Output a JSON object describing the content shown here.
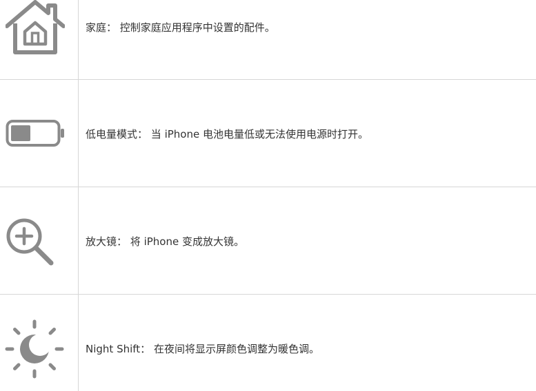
{
  "rows": [
    {
      "icon": "home-icon",
      "term": "家庭：",
      "desc": "控制家庭应用程序中设置的配件。"
    },
    {
      "icon": "low-battery-icon",
      "term": "低电量模式：",
      "desc": "当 iPhone 电池电量低或无法使用电源时打开。"
    },
    {
      "icon": "magnifier-icon",
      "term": "放大镜：",
      "desc": "将 iPhone 变成放大镜。"
    },
    {
      "icon": "night-shift-icon",
      "term": "Night Shift：",
      "desc": "在夜间将显示屏颜色调整为暖色调。"
    }
  ],
  "colors": {
    "icon": "#8a8a8a",
    "border": "#d6d6d6",
    "text": "#333333"
  }
}
